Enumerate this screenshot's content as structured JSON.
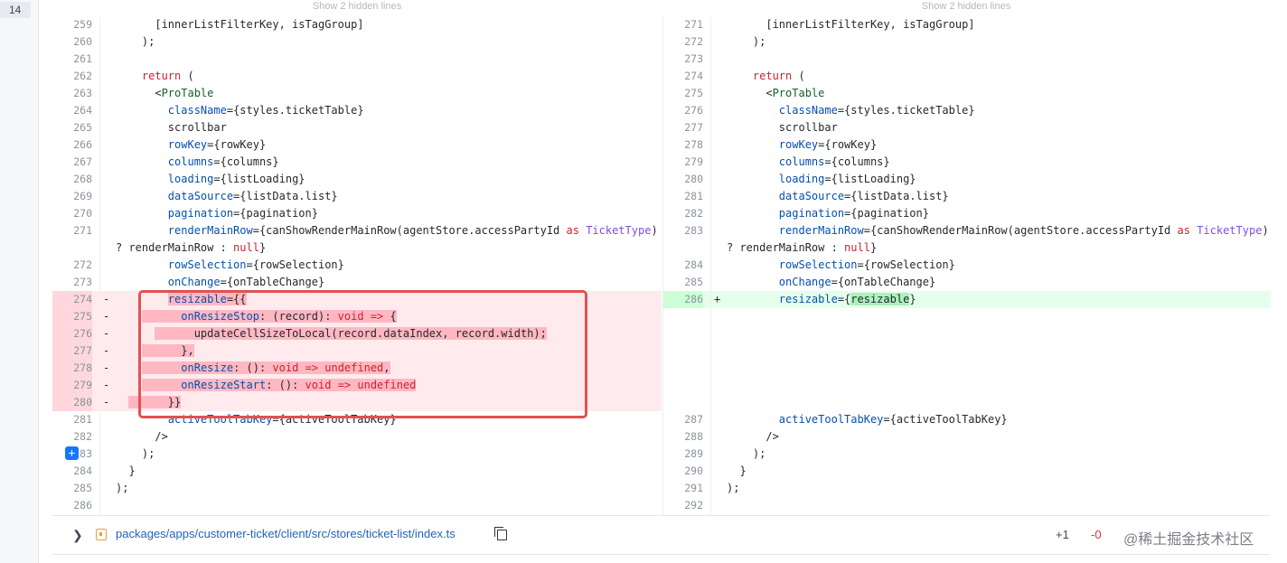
{
  "file_counter": "14",
  "hidden_lines_label": "Show 2 hidden lines",
  "left_lines": [
    {
      "n": "259",
      "sign": "",
      "type": "ctx",
      "code": "      [innerListFilterKey, isTagGroup]"
    },
    {
      "n": "260",
      "sign": "",
      "type": "ctx",
      "code": "    );"
    },
    {
      "n": "261",
      "sign": "",
      "type": "ctx",
      "code": ""
    },
    {
      "n": "262",
      "sign": "",
      "type": "ctx",
      "code": "    return ("
    },
    {
      "n": "263",
      "sign": "",
      "type": "ctx",
      "code": "      <ProTable"
    },
    {
      "n": "264",
      "sign": "",
      "type": "ctx",
      "code": "        className={styles.ticketTable}"
    },
    {
      "n": "265",
      "sign": "",
      "type": "ctx",
      "code": "        scrollbar"
    },
    {
      "n": "266",
      "sign": "",
      "type": "ctx",
      "code": "        rowKey={rowKey}"
    },
    {
      "n": "267",
      "sign": "",
      "type": "ctx",
      "code": "        columns={columns}"
    },
    {
      "n": "268",
      "sign": "",
      "type": "ctx",
      "code": "        loading={listLoading}"
    },
    {
      "n": "269",
      "sign": "",
      "type": "ctx",
      "code": "        dataSource={listData.list}"
    },
    {
      "n": "270",
      "sign": "",
      "type": "ctx",
      "code": "        pagination={pagination}"
    },
    {
      "n": "271",
      "sign": "",
      "type": "ctx",
      "code": "        renderMainRow={canShowRenderMainRow(agentStore.accessPartyId as TicketType)"
    },
    {
      "n": "",
      "sign": "",
      "type": "ctx",
      "code": "? renderMainRow : null}"
    },
    {
      "n": "272",
      "sign": "",
      "type": "ctx",
      "code": "        rowSelection={rowSelection}"
    },
    {
      "n": "273",
      "sign": "",
      "type": "ctx",
      "code": "        onChange={onTableChange}"
    },
    {
      "n": "274",
      "sign": "-",
      "type": "del",
      "code": "        resizable={{"
    },
    {
      "n": "275",
      "sign": "-",
      "type": "del",
      "code": "          onResizeStop: (record): void => {"
    },
    {
      "n": "276",
      "sign": "-",
      "type": "del",
      "code": "            updateCellSizeToLocal(record.dataIndex, record.width);"
    },
    {
      "n": "277",
      "sign": "-",
      "type": "del",
      "code": "          },"
    },
    {
      "n": "278",
      "sign": "-",
      "type": "del",
      "code": "          onResize: (): void => undefined,"
    },
    {
      "n": "279",
      "sign": "-",
      "type": "del",
      "code": "          onResizeStart: (): void => undefined"
    },
    {
      "n": "280",
      "sign": "-",
      "type": "del",
      "code": "        }}"
    },
    {
      "n": "281",
      "sign": "",
      "type": "ctx",
      "code": "        activeToolTabKey={activeToolTabKey}"
    },
    {
      "n": "282",
      "sign": "",
      "type": "ctx",
      "code": "      />"
    },
    {
      "n": "283",
      "sign": "",
      "type": "ctx",
      "code": "    );"
    },
    {
      "n": "284",
      "sign": "",
      "type": "ctx",
      "code": "  }"
    },
    {
      "n": "285",
      "sign": "",
      "type": "ctx",
      "code": ");"
    },
    {
      "n": "286",
      "sign": "",
      "type": "ctx",
      "code": ""
    }
  ],
  "right_lines": [
    {
      "n": "271",
      "sign": "",
      "type": "ctx",
      "code": "      [innerListFilterKey, isTagGroup]"
    },
    {
      "n": "272",
      "sign": "",
      "type": "ctx",
      "code": "    );"
    },
    {
      "n": "273",
      "sign": "",
      "type": "ctx",
      "code": ""
    },
    {
      "n": "274",
      "sign": "",
      "type": "ctx",
      "code": "    return ("
    },
    {
      "n": "275",
      "sign": "",
      "type": "ctx",
      "code": "      <ProTable"
    },
    {
      "n": "276",
      "sign": "",
      "type": "ctx",
      "code": "        className={styles.ticketTable}"
    },
    {
      "n": "277",
      "sign": "",
      "type": "ctx",
      "code": "        scrollbar"
    },
    {
      "n": "278",
      "sign": "",
      "type": "ctx",
      "code": "        rowKey={rowKey}"
    },
    {
      "n": "279",
      "sign": "",
      "type": "ctx",
      "code": "        columns={columns}"
    },
    {
      "n": "280",
      "sign": "",
      "type": "ctx",
      "code": "        loading={listLoading}"
    },
    {
      "n": "281",
      "sign": "",
      "type": "ctx",
      "code": "        dataSource={listData.list}"
    },
    {
      "n": "282",
      "sign": "",
      "type": "ctx",
      "code": "        pagination={pagination}"
    },
    {
      "n": "283",
      "sign": "",
      "type": "ctx",
      "code": "        renderMainRow={canShowRenderMainRow(agentStore.accessPartyId as TicketType)"
    },
    {
      "n": "",
      "sign": "",
      "type": "ctx",
      "code": "? renderMainRow : null}"
    },
    {
      "n": "284",
      "sign": "",
      "type": "ctx",
      "code": "        rowSelection={rowSelection}"
    },
    {
      "n": "285",
      "sign": "",
      "type": "ctx",
      "code": "        onChange={onTableChange}"
    },
    {
      "n": "286",
      "sign": "+",
      "type": "add",
      "code": "        resizable={resizable}"
    },
    {
      "n": "",
      "sign": "",
      "type": "empty",
      "code": ""
    },
    {
      "n": "",
      "sign": "",
      "type": "empty",
      "code": ""
    },
    {
      "n": "",
      "sign": "",
      "type": "empty",
      "code": ""
    },
    {
      "n": "",
      "sign": "",
      "type": "empty",
      "code": ""
    },
    {
      "n": "",
      "sign": "",
      "type": "empty",
      "code": ""
    },
    {
      "n": "",
      "sign": "",
      "type": "empty",
      "code": ""
    },
    {
      "n": "287",
      "sign": "",
      "type": "ctx",
      "code": "        activeToolTabKey={activeToolTabKey}"
    },
    {
      "n": "288",
      "sign": "",
      "type": "ctx",
      "code": "      />"
    },
    {
      "n": "289",
      "sign": "",
      "type": "ctx",
      "code": "    );"
    },
    {
      "n": "290",
      "sign": "",
      "type": "ctx",
      "code": "  }"
    },
    {
      "n": "291",
      "sign": "",
      "type": "ctx",
      "code": ");"
    },
    {
      "n": "292",
      "sign": "",
      "type": "ctx",
      "code": ""
    }
  ],
  "next_file": {
    "path": "packages/apps/customer-ticket/client/src/stores/ticket-list/index.ts",
    "additions": "+1",
    "deletions": "-0"
  },
  "watermark": "@稀土掘金技术社区",
  "colors": {
    "deleted_bg": "#ffebee",
    "added_bg": "#e6ffec",
    "annotation_box": "#e05252",
    "link": "#2463b8"
  },
  "icons": [
    "chevron-right-icon",
    "file-ts-icon",
    "copy-icon",
    "expand-plus-icon"
  ]
}
